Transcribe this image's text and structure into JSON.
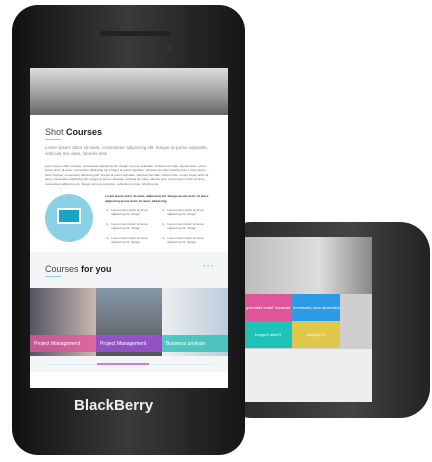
{
  "front_screen": {
    "section1": {
      "title_light": "Shot",
      "title_bold": "Courses",
      "lead": "Lorem ipsum dolor sit amet, consectetur adipiscing elit. Integer at purus vulputate, vehicula nisi vitae, lobortis ante",
      "body": "Lorem ipsum dolor sit amet, consectetur adipiscing elit. Integer at purus vulputate, vehicula nisi vitae, lobortis ante. Lorem ipsum dolor sit amet, consectetur adipiscing elit. Integer at purus vulputate, vehicula nisi vitae, lobortis ante. Lorem ipsum dolor sit amet, consectetur adipiscing elit. Integer at purus vulputate, vehicula nisi vitae, lobortis ante. Lorem ipsum dolor sit amet, consectetur adipiscing elit. Integer at purus vulputate, vehicula nisi vitae, lobortis ante. Lorem ipsum dolor sit amet, consectetur adipiscing elit. Integer at purus vulputate, vehicula nisi vitae, lobortis ante.",
      "list_title": "Lorem ipsum dolor sit amet, adipiscing elit. Integer ipsum dolor sit amet, adipiscing ipsum dolor sit amet, adipiscing.",
      "items": [
        "Lorem ipsum dolor sit amet, adipiscing elit. Integer",
        "Lorem ipsum dolor sit amet, adipiscing elit. Integer",
        "Lorem ipsum dolor sit amet, adipiscing elit. Integer",
        "Lorem ipsum dolor sit amet, adipiscing elit. Integer",
        "Lorem ipsum dolor sit amet, adipiscing elit. Integer",
        "Lorem ipsum dolor sit amet, adipiscing elit. Integer"
      ]
    },
    "section2": {
      "title_light": "Courses",
      "title_bold": "for you",
      "cards": [
        {
          "label": "Project Management",
          "color": "#e0559a"
        },
        {
          "label": "Project Management",
          "color": "#9b4fd6"
        },
        {
          "label": "Business analysis",
          "color": "#2bbfb6"
        }
      ]
    }
  },
  "back_screen": {
    "tiles": [
      {
        "label": "Advance Talent Matching",
        "color": "#e0559a"
      },
      {
        "label": "Internship work placement",
        "color": "#2c9be6"
      },
      {
        "label": "Thesis Support",
        "color": "#1dc3b9"
      },
      {
        "label": "IT Support",
        "color": "#e2c84a"
      }
    ]
  },
  "brand": "BlackBerry"
}
